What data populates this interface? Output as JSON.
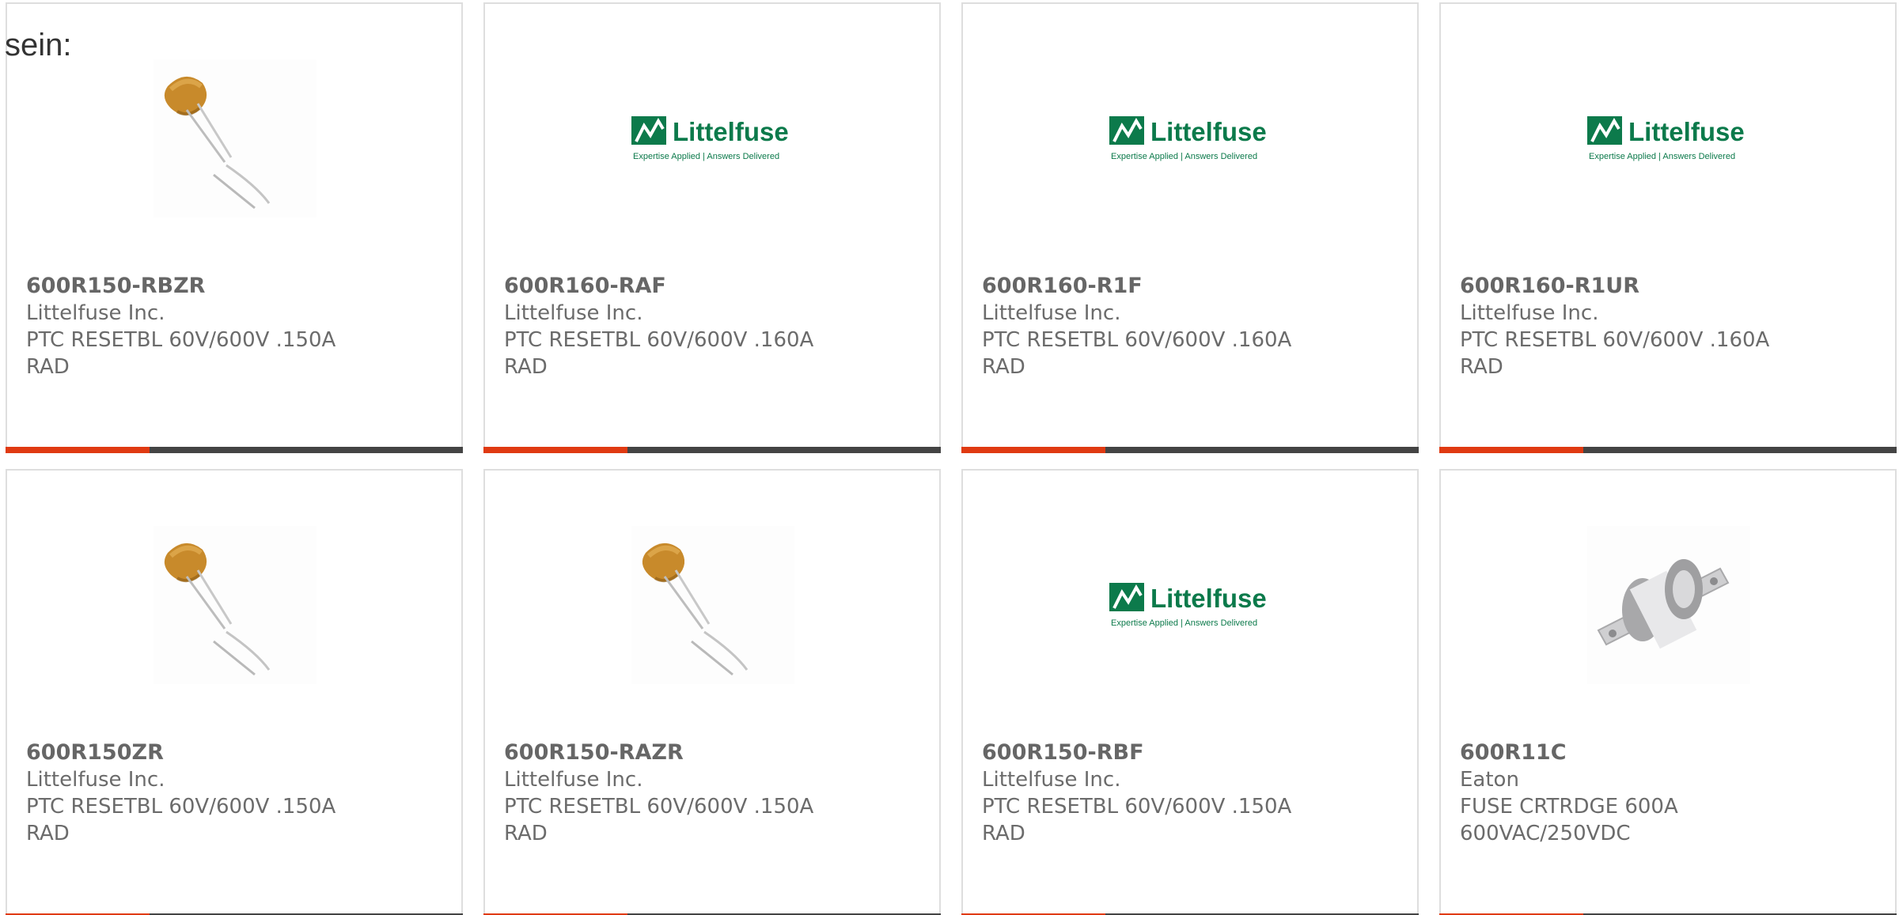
{
  "intro_text": "sein:",
  "colors": {
    "accent": "#e03a12",
    "bar": "#444444",
    "border": "#dedede",
    "text": "#6b6b6b"
  },
  "products": [
    {
      "part_number": "600R150-RBZR",
      "manufacturer": "Littelfuse Inc.",
      "description_line1": "PTC RESETBL 60V/600V .150A",
      "description_line2": "RAD",
      "image": "ptc-thermistor-image"
    },
    {
      "part_number": "600R160-RAF",
      "manufacturer": "Littelfuse Inc.",
      "description_line1": "PTC RESETBL 60V/600V .160A",
      "description_line2": "RAD",
      "image": "littelfuse-logo",
      "logo_text": "Littelfuse",
      "logo_tagline": "Expertise Applied | Answers Delivered"
    },
    {
      "part_number": "600R160-R1F",
      "manufacturer": "Littelfuse Inc.",
      "description_line1": "PTC RESETBL 60V/600V .160A",
      "description_line2": "RAD",
      "image": "littelfuse-logo",
      "logo_text": "Littelfuse",
      "logo_tagline": "Expertise Applied | Answers Delivered"
    },
    {
      "part_number": "600R160-R1UR",
      "manufacturer": "Littelfuse Inc.",
      "description_line1": "PTC RESETBL 60V/600V .160A",
      "description_line2": "RAD",
      "image": "littelfuse-logo",
      "logo_text": "Littelfuse",
      "logo_tagline": "Expertise Applied | Answers Delivered"
    },
    {
      "part_number": "600R150ZR",
      "manufacturer": "Littelfuse Inc.",
      "description_line1": "PTC RESETBL 60V/600V .150A",
      "description_line2": "RAD",
      "image": "ptc-thermistor-image"
    },
    {
      "part_number": "600R150-RAZR",
      "manufacturer": "Littelfuse Inc.",
      "description_line1": "PTC RESETBL 60V/600V .150A",
      "description_line2": "RAD",
      "image": "ptc-thermistor-image"
    },
    {
      "part_number": "600R150-RBF",
      "manufacturer": "Littelfuse Inc.",
      "description_line1": "PTC RESETBL 60V/600V .150A",
      "description_line2": "RAD",
      "image": "littelfuse-logo",
      "logo_text": "Littelfuse",
      "logo_tagline": "Expertise Applied | Answers Delivered"
    },
    {
      "part_number": "600R11C",
      "manufacturer": "Eaton",
      "description_line1": "FUSE CRTRDGE 600A",
      "description_line2": "600VAC/250VDC",
      "image": "cartridge-fuse-image"
    }
  ]
}
